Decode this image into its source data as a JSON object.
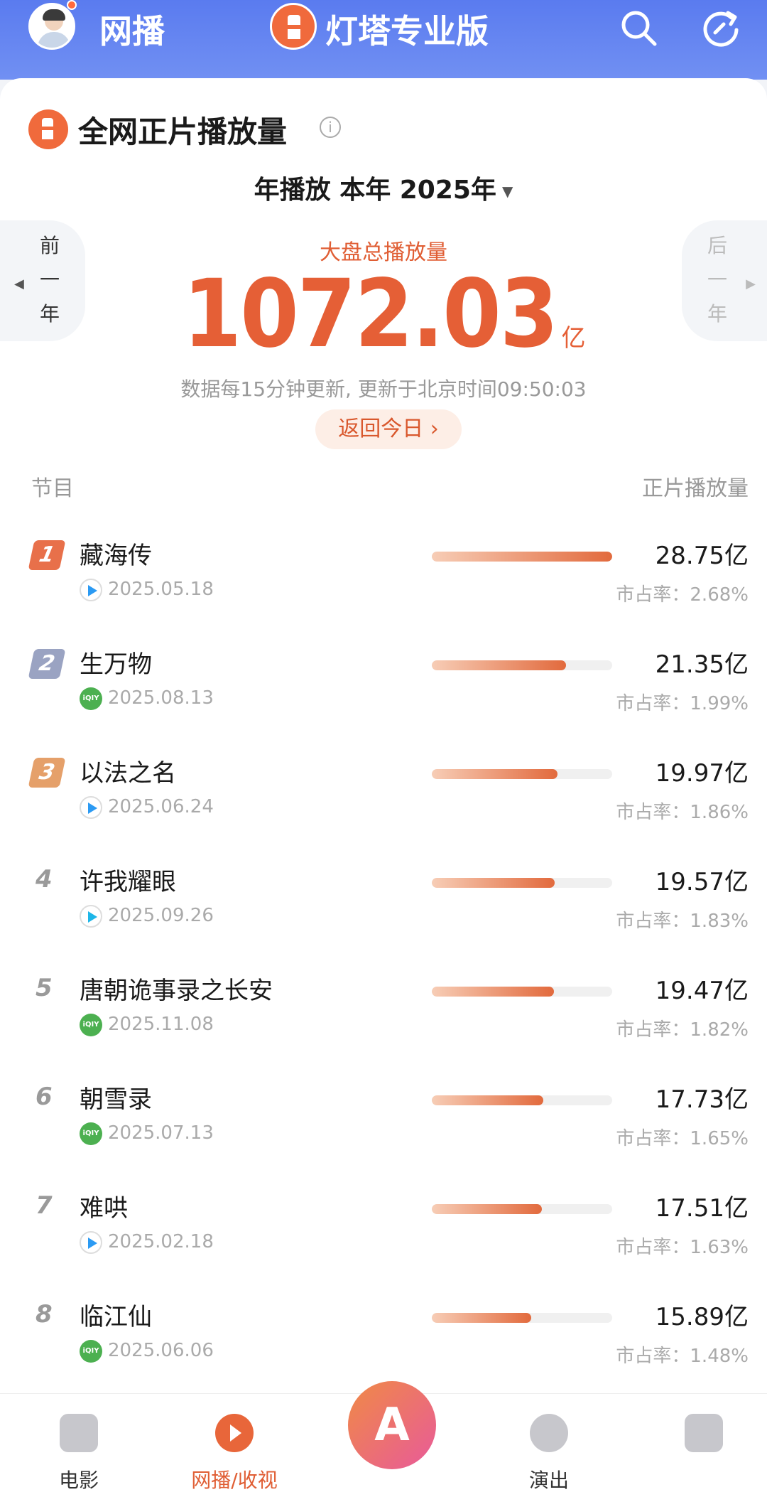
{
  "header": {
    "tab_label": "网播",
    "brand_title": "灯塔专业版",
    "icons": [
      "avatar",
      "lighthouse-logo",
      "search-icon",
      "refresh-icon"
    ]
  },
  "section": {
    "title": "全网正片播放量",
    "info_icon": "info-icon",
    "period": "年播放  本年  2025年",
    "prev_label": [
      "前",
      "一",
      "年"
    ],
    "next_label": [
      "后",
      "一",
      "年"
    ],
    "total_label": "大盘总播放量",
    "total_value": "1072.03",
    "total_unit": "亿",
    "update_note": "数据每15分钟更新, 更新于北京时间09:50:03",
    "back_today": "返回今日 ›",
    "col_program": "节目",
    "col_plays": "正片播放量"
  },
  "colors": {
    "accent": "#e55f36",
    "header_blue": "#5a7bef",
    "rank1": "#e8704a",
    "rank2": "#9aa3c2",
    "rank3": "#e5a06a"
  },
  "ranking": [
    {
      "rank": "1",
      "name": "藏海传",
      "platform": "tencent",
      "date": "2025.05.18",
      "plays": "28.75亿",
      "share": "市占率：2.68%",
      "bar": 1.0
    },
    {
      "rank": "2",
      "name": "生万物",
      "platform": "iqiyi",
      "date": "2025.08.13",
      "plays": "21.35亿",
      "share": "市占率：1.99%",
      "bar": 0.743
    },
    {
      "rank": "3",
      "name": "以法之名",
      "platform": "tencent",
      "date": "2025.06.24",
      "plays": "19.97亿",
      "share": "市占率：1.86%",
      "bar": 0.695
    },
    {
      "rank": "4",
      "name": "许我耀眼",
      "platform": "youku",
      "date": "2025.09.26",
      "plays": "19.57亿",
      "share": "市占率：1.83%",
      "bar": 0.681
    },
    {
      "rank": "5",
      "name": "唐朝诡事录之长安",
      "platform": "iqiyi",
      "date": "2025.11.08",
      "plays": "19.47亿",
      "share": "市占率：1.82%",
      "bar": 0.677
    },
    {
      "rank": "6",
      "name": "朝雪录",
      "platform": "iqiyi",
      "date": "2025.07.13",
      "plays": "17.73亿",
      "share": "市占率：1.65%",
      "bar": 0.617
    },
    {
      "rank": "7",
      "name": "难哄",
      "platform": "tencent",
      "date": "2025.02.18",
      "plays": "17.51亿",
      "share": "市占率：1.63%",
      "bar": 0.609
    },
    {
      "rank": "8",
      "name": "临江仙",
      "platform": "iqiyi",
      "date": "2025.06.06",
      "plays": "15.89亿",
      "share": "市占率：1.48%",
      "bar": 0.553
    }
  ],
  "bottom_nav": [
    {
      "label": "电影",
      "icon": "movie-icon"
    },
    {
      "label": "网播/收视",
      "icon": "play-icon",
      "active": true
    },
    {
      "label": "",
      "icon": "ai-icon"
    },
    {
      "label": "演出",
      "icon": "mic-icon"
    },
    {
      "label": "",
      "icon": "doc-icon"
    }
  ],
  "iqiyi_text": "iQIY"
}
